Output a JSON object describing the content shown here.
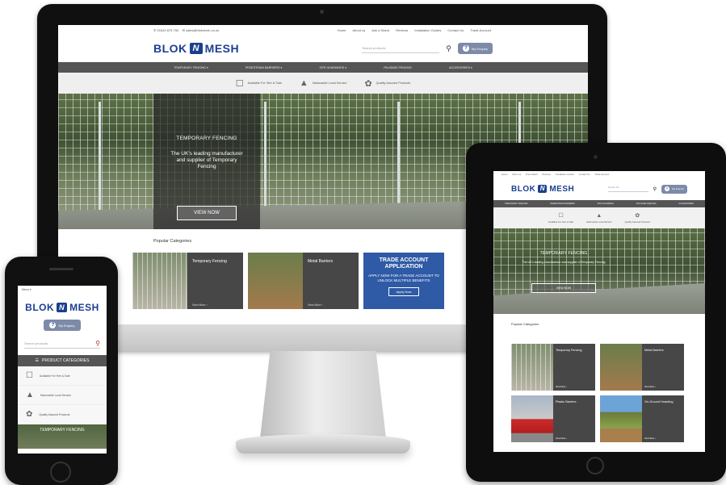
{
  "brand": {
    "name_left": "BLOK",
    "name_right": "MESH",
    "mark": "N",
    "color": "#1b3f8f"
  },
  "desktop": {
    "topbar": {
      "phone": "✆ 01543 675 750",
      "email": "✉ sales@blokmesh.co.uk",
      "links": [
        "Home",
        "About us",
        "Ask a Stand",
        "Reviews",
        "Installation Guides",
        "Contact Us",
        "Trade Account"
      ]
    },
    "search_placeholder": "Search products",
    "enquiry_label": "My Enquiry",
    "nav": [
      "TEMPORARY FENCING ▾",
      "PEDESTRIAN BARRIERS ▾",
      "SITE HOARDINGS ▾",
      "PALISADE FENCING",
      "ACCESSORIES ▾"
    ],
    "usps": [
      "Available For Hire & Sale",
      "Nationwide Local Service",
      "Quality Assured Products"
    ],
    "hero": {
      "title": "TEMPORARY FENCING",
      "subtitle": "The UK's leading manufacturer and supplier of Temporary Fencing",
      "button": "VIEW NOW"
    },
    "popular_heading": "Popular Categories",
    "cards": [
      {
        "title": "Temporary Fencing",
        "more": "View More ›"
      },
      {
        "title": "Metal Barriers",
        "more": "View More ›"
      }
    ],
    "trade": {
      "title": "TRADE ACCOUNT APPLICATION",
      "body": "APPLY NOW FOR A TRADE ACCOUNT TO UNLOCK MULTIPLE BENEFITS",
      "button": "Apply Now"
    }
  },
  "tablet": {
    "topbar": [
      "Home",
      "About us",
      "Price Match",
      "Reviews",
      "Installation Guides",
      "Contact Us",
      "Trade Account"
    ],
    "search_placeholder": "Search All",
    "enquiry_label": "My Enquiry",
    "nav": [
      "TEMPORARY FENCING",
      "PEDESTRIAN BARRIERS",
      "SITE HOARDING",
      "PALISADE FENCING",
      "ACCESSORIES"
    ],
    "usps": [
      "Available For Hire & Sale",
      "Nationwide Local Service",
      "Quality Assured Products"
    ],
    "hero": {
      "title": "TEMPORARY FENCING",
      "subtitle": "The UK's leading manufacturer and supplier of Temporary Fencing",
      "button": "VIEW NOW"
    },
    "popular_heading": "Popular Categories",
    "cards": [
      {
        "title": "Temporary Fencing",
        "more": "View More ›"
      },
      {
        "title": "Metal Barriers",
        "more": "View More ›"
      },
      {
        "title": "Plastic Barriers",
        "more": "View More ›"
      },
      {
        "title": "On-Ground Hoarding",
        "more": "View More ›"
      }
    ]
  },
  "phone": {
    "menu": "Menu ▾",
    "enquiry_label": "My Enquiry",
    "search_placeholder": "Search products",
    "categories_label": "PRODUCT CATEGORIES",
    "usps": [
      "Available For Hire & Sale",
      "Nationwide Local Service",
      "Quality Assured Products"
    ],
    "hero_title": "TEMPORARY FENCING"
  }
}
